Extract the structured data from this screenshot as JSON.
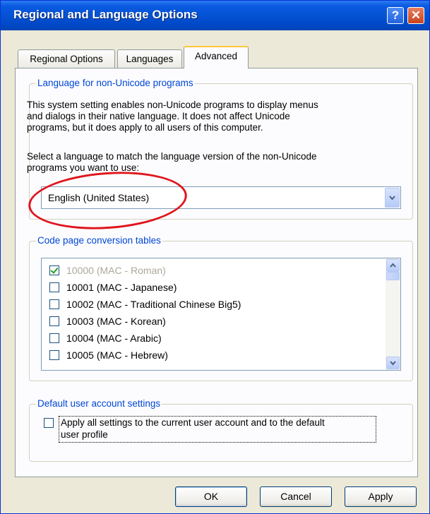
{
  "window": {
    "title": "Regional and Language Options",
    "help_label": "?",
    "close_label": "✕"
  },
  "tabs": [
    {
      "label": "Regional Options"
    },
    {
      "label": "Languages"
    },
    {
      "label": "Advanced",
      "active": true
    }
  ],
  "nonunicode": {
    "legend": "Language for non-Unicode programs",
    "description_lines": [
      "This system setting enables non-Unicode programs to display menus",
      "and dialogs in their native language. It does not affect Unicode",
      "programs, but it does apply to all users of this computer."
    ],
    "select_prompt_lines": [
      "Select a language to match the language version of the non-Unicode",
      "programs you want to use:"
    ],
    "selected_language": "English (United States)"
  },
  "codepages": {
    "legend": "Code page conversion tables",
    "items": [
      {
        "label": "10000 (MAC - Roman)",
        "checked": true,
        "disabled": true
      },
      {
        "label": "10001 (MAC - Japanese)",
        "checked": false,
        "disabled": false
      },
      {
        "label": "10002 (MAC - Traditional Chinese Big5)",
        "checked": false,
        "disabled": false
      },
      {
        "label": "10003 (MAC - Korean)",
        "checked": false,
        "disabled": false
      },
      {
        "label": "10004 (MAC - Arabic)",
        "checked": false,
        "disabled": false
      },
      {
        "label": "10005 (MAC - Hebrew)",
        "checked": false,
        "disabled": false
      }
    ]
  },
  "default_user": {
    "legend": "Default user account settings",
    "apply_label_lines": [
      "Apply all settings to the current user account and to the default",
      "user profile"
    ],
    "checked": false
  },
  "buttons": {
    "ok": "OK",
    "cancel": "Cancel",
    "apply": "Apply"
  },
  "colors": {
    "titlebar": "#0452d4",
    "group_legend": "#0046d5",
    "highlight_ellipse": "#e0141c",
    "active_tab_accent": "#ffc83c"
  },
  "icons": {
    "help": "question-mark-icon",
    "close": "close-x-icon",
    "dropdown": "chevron-down-icon",
    "scroll_up": "chevron-up-icon",
    "scroll_down": "chevron-down-icon",
    "check": "checkmark-icon"
  }
}
